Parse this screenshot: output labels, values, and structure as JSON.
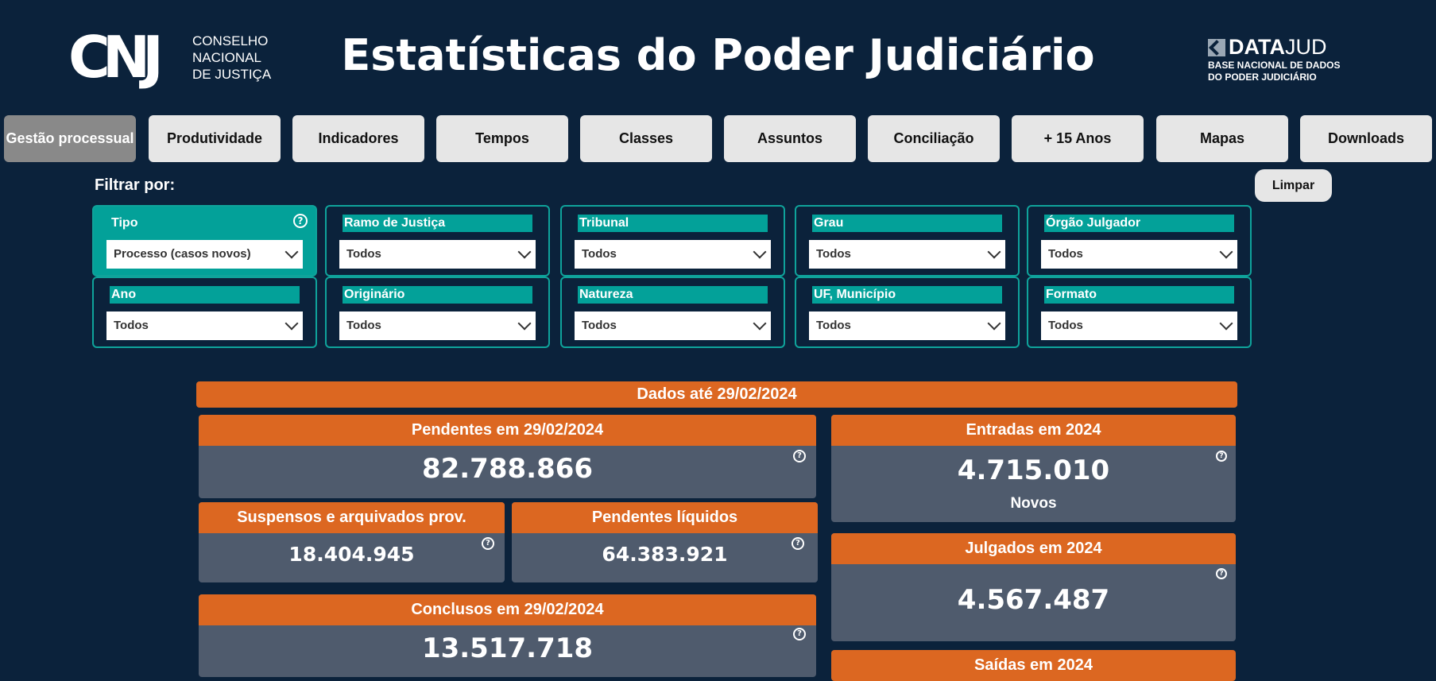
{
  "header": {
    "cnj_letters": "CNJ",
    "cnj_line1": "CONSELHO",
    "cnj_line2": "NACIONAL",
    "cnj_line3": "DE JUSTIÇA",
    "title": "Estatísticas do Poder Judiciário",
    "datajud_bold": "DATA",
    "datajud_light": "JUD",
    "datajud_sub1": "BASE NACIONAL DE DADOS",
    "datajud_sub2": "DO PODER JUDICIÁRIO"
  },
  "tabs": [
    {
      "label": "Gestão processual",
      "active": true
    },
    {
      "label": "Produtividade"
    },
    {
      "label": "Indicadores"
    },
    {
      "label": "Tempos"
    },
    {
      "label": "Classes"
    },
    {
      "label": "Assuntos"
    },
    {
      "label": "Conciliação"
    },
    {
      "label": "+ 15 Anos"
    },
    {
      "label": "Mapas"
    },
    {
      "label": "Downloads"
    }
  ],
  "filters": {
    "title": "Filtrar por:",
    "clear_label": "Limpar",
    "items": [
      {
        "label": "Tipo",
        "value": "Processo (casos novos)"
      },
      {
        "label": "Ramo de Justiça",
        "value": "Todos"
      },
      {
        "label": "Tribunal",
        "value": "Todos"
      },
      {
        "label": "Grau",
        "value": "Todos"
      },
      {
        "label": "Órgão Julgador",
        "value": "Todos"
      },
      {
        "label": "Ano",
        "value": "Todos"
      },
      {
        "label": "Originário",
        "value": "Todos"
      },
      {
        "label": "Natureza",
        "value": "Todos"
      },
      {
        "label": "UF, Município",
        "value": "Todos"
      },
      {
        "label": "Formato",
        "value": "Todos"
      }
    ]
  },
  "data_header": "Dados até 29/02/2024",
  "cards": {
    "pendentes": {
      "title": "Pendentes em 29/02/2024",
      "value": "82.788.866"
    },
    "suspensos": {
      "title": "Suspensos e arquivados prov.",
      "value": "18.404.945"
    },
    "liquidos": {
      "title": "Pendentes líquidos",
      "value": "64.383.921"
    },
    "conclusos": {
      "title": "Conclusos em 29/02/2024",
      "value": "13.517.718"
    },
    "entradas": {
      "title": "Entradas em 2024",
      "value": "4.715.010",
      "sub": "Novos"
    },
    "julgados": {
      "title": "Julgados em 2024",
      "value": "4.567.487"
    },
    "saidas": {
      "title": "Saídas em 2024"
    }
  },
  "help_glyph": "?",
  "colors": {
    "background": "#0b223b",
    "accent_orange": "#dc6721",
    "accent_teal": "#03a199",
    "card_body": "#4f5b6d"
  }
}
